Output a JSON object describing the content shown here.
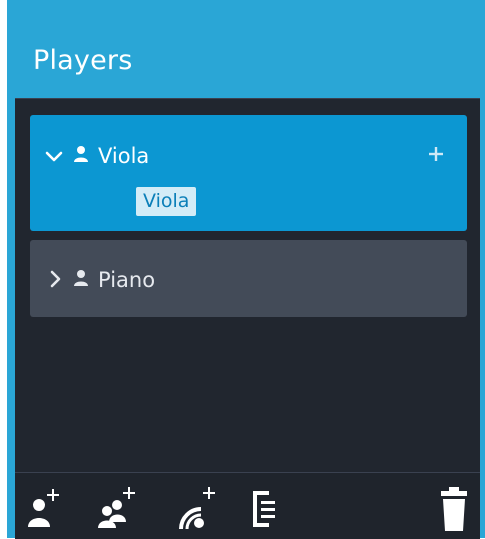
{
  "panel": {
    "title": "Players",
    "accent_color": "#2aa6d6"
  },
  "players": [
    {
      "name": "Viola",
      "expanded": true,
      "icon": "person-icon",
      "instruments": [
        "Viola"
      ],
      "add_icon": "plus-icon"
    },
    {
      "name": "Piano",
      "expanded": false,
      "icon": "person-icon"
    }
  ],
  "toolbar": {
    "buttons": [
      {
        "icon": "add-player-icon"
      },
      {
        "icon": "add-group-icon"
      },
      {
        "icon": "add-sound-icon"
      },
      {
        "icon": "layout-icon"
      },
      {
        "icon": "delete-icon"
      }
    ]
  }
}
